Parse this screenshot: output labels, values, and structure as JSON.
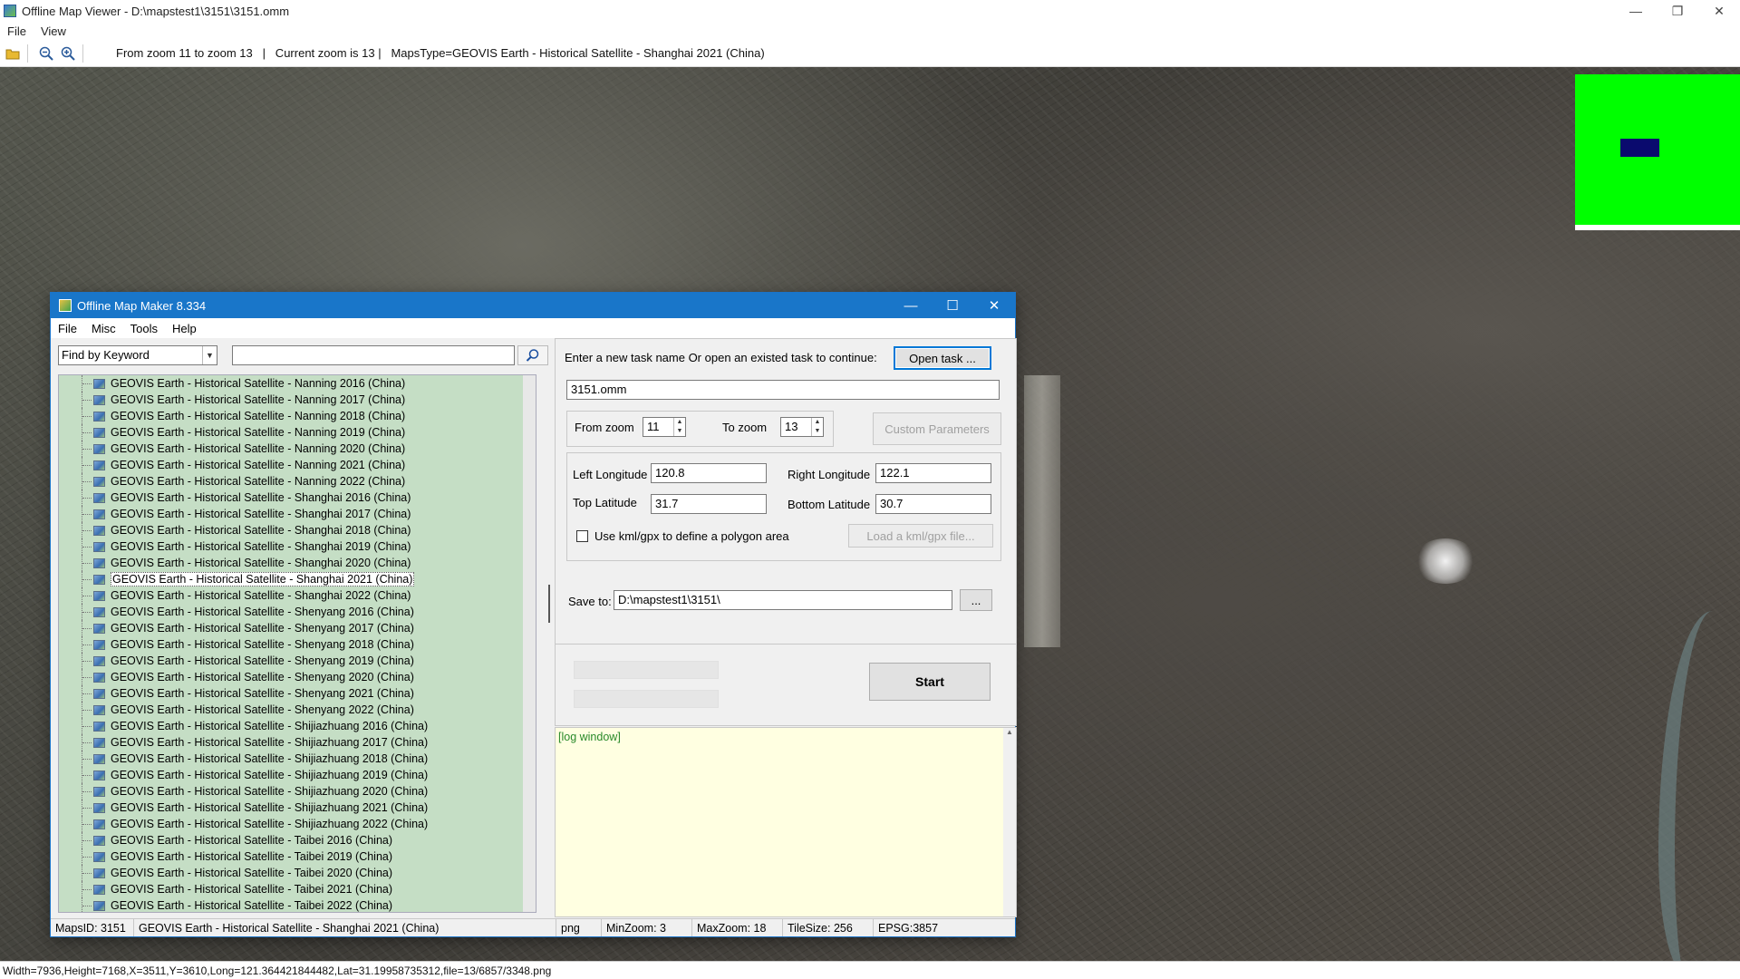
{
  "window": {
    "title": "Offline Map Viewer - D:\\mapstest1\\3151\\3151.omm",
    "controls": [
      "—",
      "❐",
      "✕"
    ]
  },
  "menu": [
    "File",
    "View"
  ],
  "toolbar": {
    "info": "From zoom 11 to zoom 13   |   Current zoom is 13 |   MapsType=GEOVIS Earth - Historical Satellite - Shanghai 2021 (China)"
  },
  "statusbar": {
    "text": "Width=7936,Height=7168,X=3511,Y=3610,Long=121.364421844482,Lat=31.19958735312,file=13/6857/3348.png"
  },
  "dialog": {
    "title": "Offline Map Maker 8.334",
    "menu": [
      "File",
      "Misc",
      "Tools",
      "Help"
    ],
    "search": {
      "mode": "Find by Keyword",
      "value": ""
    },
    "tree_items": [
      "GEOVIS Earth - Historical Satellite - Nanning 2016 (China)",
      "GEOVIS Earth - Historical Satellite - Nanning 2017 (China)",
      "GEOVIS Earth - Historical Satellite - Nanning 2018 (China)",
      "GEOVIS Earth - Historical Satellite - Nanning 2019 (China)",
      "GEOVIS Earth - Historical Satellite - Nanning 2020 (China)",
      "GEOVIS Earth - Historical Satellite - Nanning 2021 (China)",
      "GEOVIS Earth - Historical Satellite - Nanning 2022 (China)",
      "GEOVIS Earth - Historical Satellite - Shanghai 2016 (China)",
      "GEOVIS Earth - Historical Satellite - Shanghai 2017 (China)",
      "GEOVIS Earth - Historical Satellite - Shanghai 2018 (China)",
      "GEOVIS Earth - Historical Satellite - Shanghai 2019 (China)",
      "GEOVIS Earth - Historical Satellite - Shanghai 2020 (China)",
      "GEOVIS Earth - Historical Satellite - Shanghai 2021 (China)",
      "GEOVIS Earth - Historical Satellite - Shanghai 2022 (China)",
      "GEOVIS Earth - Historical Satellite - Shenyang 2016 (China)",
      "GEOVIS Earth - Historical Satellite - Shenyang 2017 (China)",
      "GEOVIS Earth - Historical Satellite - Shenyang 2018 (China)",
      "GEOVIS Earth - Historical Satellite - Shenyang 2019 (China)",
      "GEOVIS Earth - Historical Satellite - Shenyang 2020 (China)",
      "GEOVIS Earth - Historical Satellite - Shenyang 2021 (China)",
      "GEOVIS Earth - Historical Satellite - Shenyang 2022 (China)",
      "GEOVIS Earth - Historical Satellite - Shijiazhuang 2016 (China)",
      "GEOVIS Earth - Historical Satellite - Shijiazhuang 2017 (China)",
      "GEOVIS Earth - Historical Satellite - Shijiazhuang 2018 (China)",
      "GEOVIS Earth - Historical Satellite - Shijiazhuang 2019 (China)",
      "GEOVIS Earth - Historical Satellite - Shijiazhuang 2020 (China)",
      "GEOVIS Earth - Historical Satellite - Shijiazhuang 2021 (China)",
      "GEOVIS Earth - Historical Satellite - Shijiazhuang 2022 (China)",
      "GEOVIS Earth - Historical Satellite - Taibei 2016 (China)",
      "GEOVIS Earth - Historical Satellite - Taibei 2019 (China)",
      "GEOVIS Earth - Historical Satellite - Taibei 2020 (China)",
      "GEOVIS Earth - Historical Satellite - Taibei 2021 (China)",
      "GEOVIS Earth - Historical Satellite - Taibei 2022 (China)"
    ],
    "selected_item": "GEOVIS Earth - Historical Satellite - Shanghai 2021 (China)",
    "task": {
      "prompt": "Enter a new task name Or open an existed task to continue:",
      "open_label": "Open task ...",
      "name": "3151.omm"
    },
    "zoom": {
      "from_label": "From zoom",
      "from_value": "11",
      "to_label": "To zoom",
      "to_value": "13",
      "custom_label": "Custom Parameters"
    },
    "bounds": {
      "left_lon_label": "Left Longitude",
      "left_lon": "120.8",
      "right_lon_label": "Right Longitude",
      "right_lon": "122.1",
      "top_lat_label": "Top Latitude",
      "top_lat": "31.7",
      "bottom_lat_label": "Bottom Latitude",
      "bottom_lat": "30.7",
      "kml_label": "Use kml/gpx to define a polygon area",
      "load_label": "Load a kml/gpx file..."
    },
    "save": {
      "label": "Save to:",
      "path": "D:\\mapstest1\\3151\\",
      "browse": "..."
    },
    "start_label": "Start",
    "log_text": "[log window]",
    "status": {
      "maps_id": "MapsID: 3151",
      "maps_name": "GEOVIS Earth - Historical Satellite - Shanghai 2021 (China)",
      "format": "png",
      "min_zoom": "MinZoom: 3",
      "max_zoom": "MaxZoom: 18",
      "tile_size": "TileSize: 256",
      "epsg": "EPSG:3857"
    }
  },
  "colors": {
    "dialog_title": "#1976c9",
    "tree_bg": "#c5dec5",
    "minimap": "#00ff00",
    "minimap_viewport": "#0a0a6e",
    "log_bg": "#ffffe1"
  }
}
